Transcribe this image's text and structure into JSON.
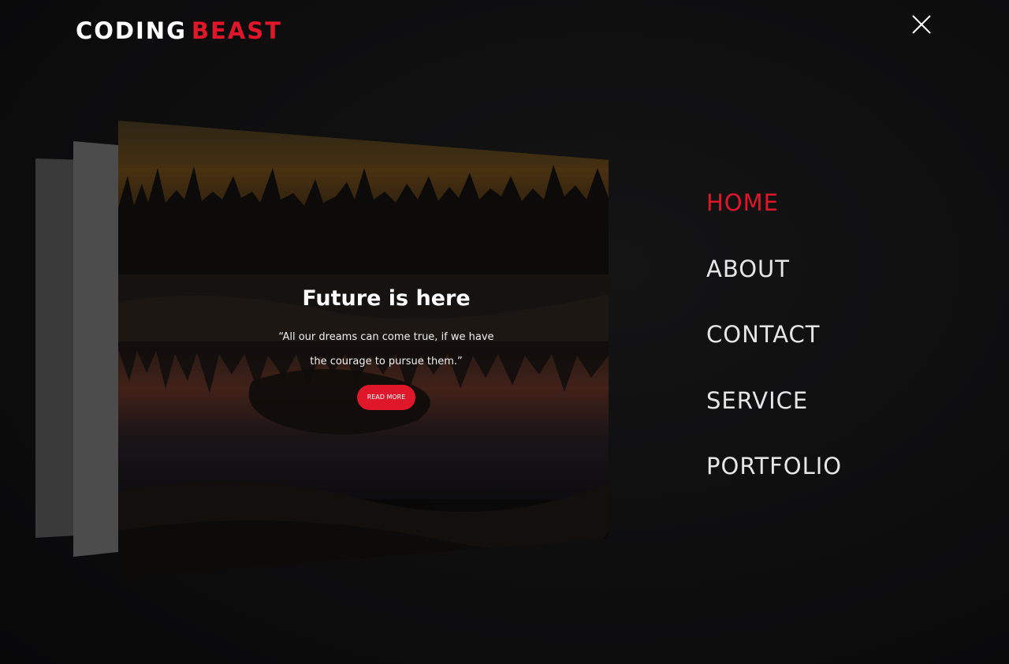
{
  "logo": {
    "first": "CODING",
    "second": "BEAST"
  },
  "header": {
    "close_icon": "close-icon"
  },
  "card": {
    "title": "Future is here",
    "quote": "“All our dreams can come true, if we have the courage to pursue them.”",
    "button_label": "READ MORE"
  },
  "nav": {
    "items": [
      {
        "label": "HOME",
        "active": true
      },
      {
        "label": "ABOUT",
        "active": false
      },
      {
        "label": "CONTACT",
        "active": false
      },
      {
        "label": "SERVICE",
        "active": false
      },
      {
        "label": "PORTFOLIO",
        "active": false
      }
    ]
  },
  "colors": {
    "accent": "#e0162b",
    "background": "#0d0d0e",
    "nav_text": "#e6e6e6"
  }
}
